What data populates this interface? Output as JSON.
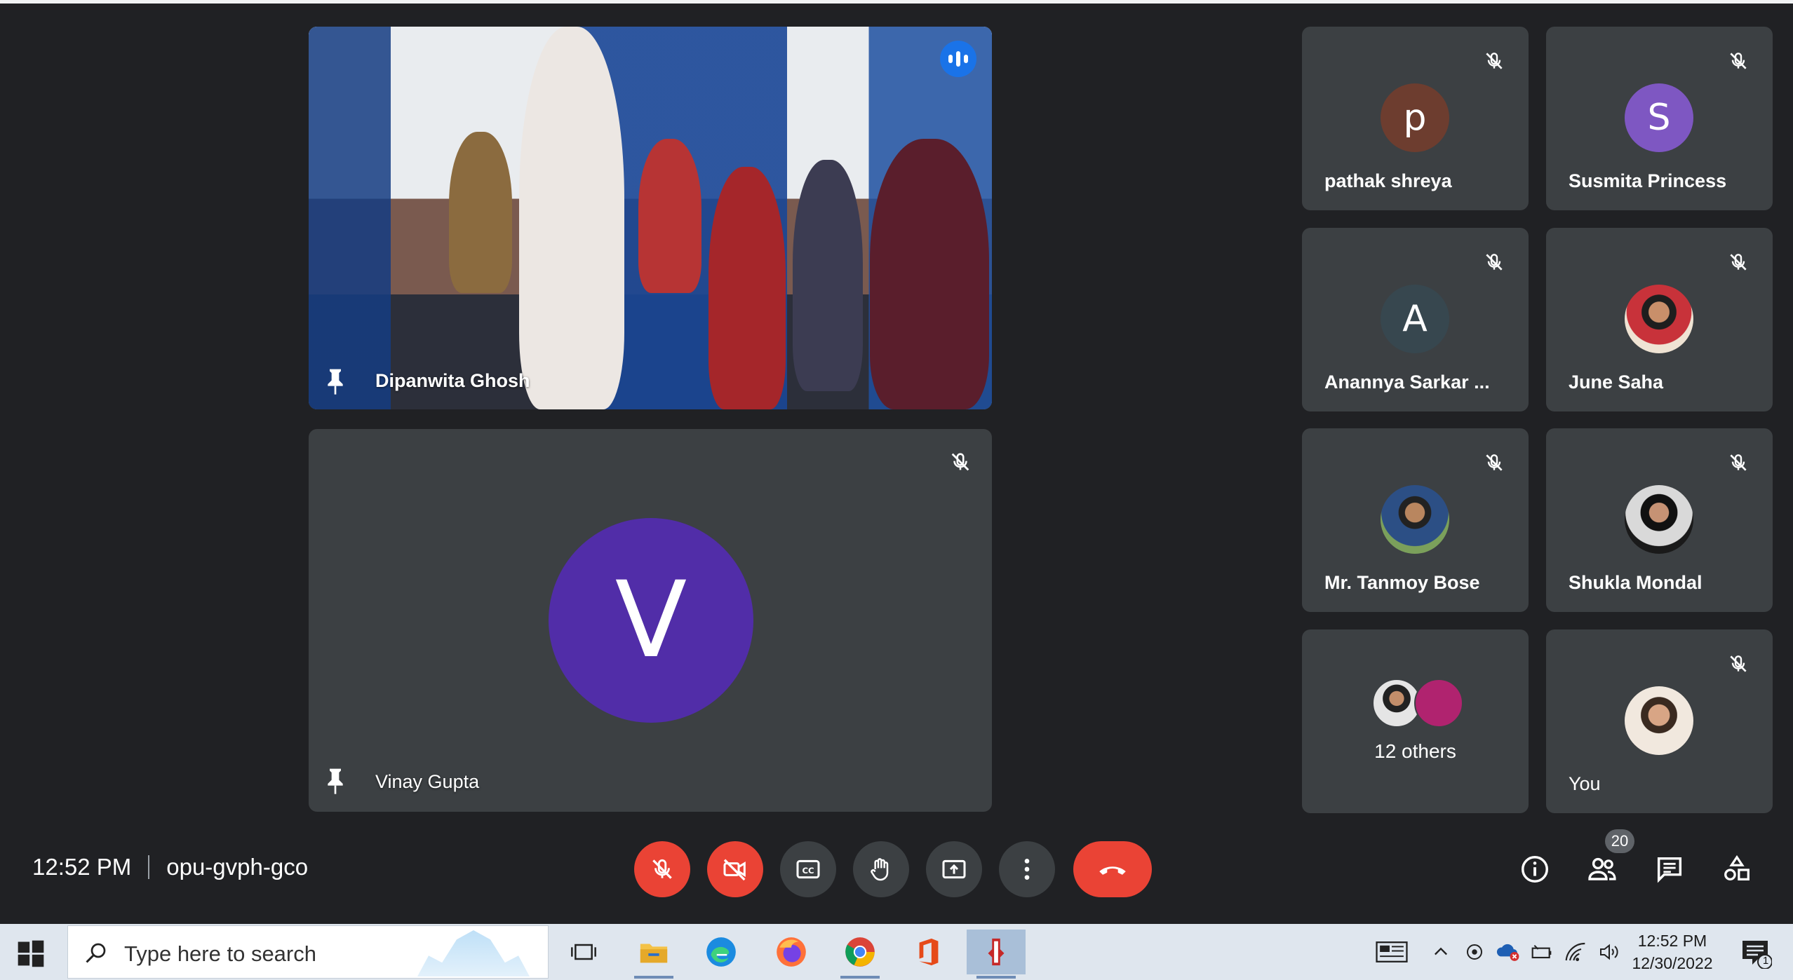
{
  "meeting": {
    "time": "12:52 PM",
    "code": "opu-gvph-gco",
    "participant_count": "20"
  },
  "main_tiles": [
    {
      "name": "Dipanwita Ghosh",
      "speaking": true,
      "video": true
    },
    {
      "name": "Vinay Gupta",
      "initial": "V",
      "muted": true
    }
  ],
  "grid_tiles": [
    {
      "name": "pathak shreya",
      "initial": "p",
      "avatar_color": "#6d3d2f",
      "muted": true
    },
    {
      "name": "Susmita Princess",
      "initial": "S",
      "avatar_color": "#7e57c2",
      "muted": true
    },
    {
      "name": "Anannya Sarkar ...",
      "initial": "A",
      "avatar_color": "#37474f",
      "muted": true
    },
    {
      "name": "June Saha",
      "avatar": "photo",
      "muted": true
    },
    {
      "name": "Mr. Tanmoy Bose",
      "avatar": "photo",
      "muted": true
    },
    {
      "name": "Shukla Mondal",
      "avatar": "photo",
      "muted": true
    },
    {
      "name": "12 others",
      "avatar": "stacked-photos"
    },
    {
      "name": "You",
      "avatar": "photo",
      "muted": true
    }
  ],
  "controls": {
    "mic": "mic-off-icon",
    "camera": "camera-off-icon",
    "captions": "closed-captions-icon",
    "raise_hand": "hand-icon",
    "present": "present-screen-icon",
    "more": "more-vert-icon",
    "leave": "call-end-icon"
  },
  "right_controls": [
    "info-icon",
    "people-icon",
    "chat-icon",
    "activities-icon"
  ],
  "taskbar": {
    "search_placeholder": "Type here to search",
    "apps": [
      "task-view-icon",
      "file-explorer-icon",
      "edge-icon",
      "firefox-icon",
      "chrome-icon",
      "office-icon",
      "app-icon"
    ],
    "time": "12:52 PM",
    "date": "12/30/2022",
    "notification_count": "1"
  },
  "colors": {
    "background": "#202124",
    "tile": "#3c4043",
    "accent_blue": "#8ab4f8",
    "danger_red": "#ea4335",
    "big_avatar": "#512da8"
  }
}
